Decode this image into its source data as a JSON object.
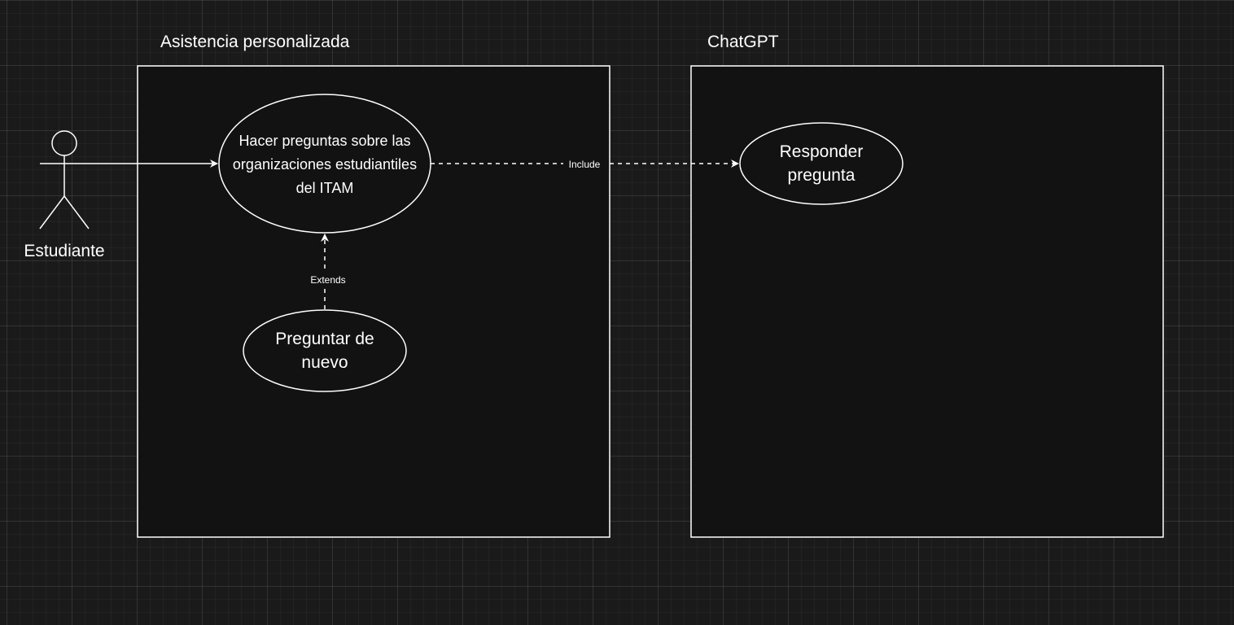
{
  "colors": {
    "background": "#1a1a1a",
    "shape_fill": "#121212",
    "stroke": "#ffffff",
    "text": "#ffffff"
  },
  "actor": {
    "label": "Estudiante",
    "icon": "stick-figure-icon"
  },
  "boundaries": [
    {
      "title": "Asistencia personalizada"
    },
    {
      "title": "ChatGPT"
    }
  ],
  "use_cases": {
    "hacer_preguntas": {
      "lines": [
        "Hacer preguntas sobre las",
        "organizaciones estudiantiles",
        "del ITAM"
      ]
    },
    "preguntar_de_nuevo": {
      "lines": [
        "Preguntar de",
        "nuevo"
      ]
    },
    "responder_pregunta": {
      "lines": [
        "Responder",
        "pregunta"
      ]
    }
  },
  "relations": {
    "include_label": "Include",
    "extends_label": "Extends"
  }
}
